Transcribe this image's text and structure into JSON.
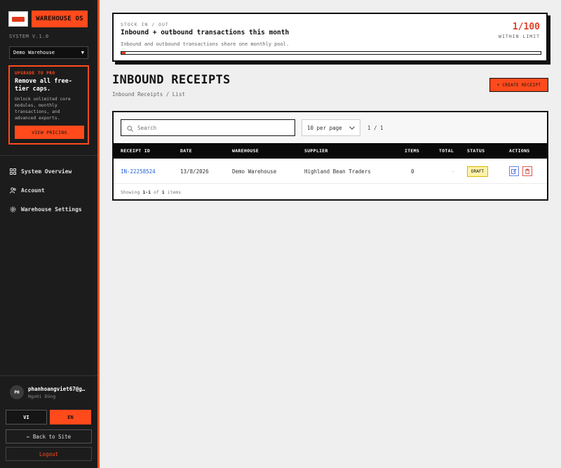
{
  "app": {
    "name": "WAREHOUSE OS",
    "version": "SYSTEM V.1.0",
    "warehouse_selected": "Demo Warehouse"
  },
  "promo": {
    "kicker": "UPGRADE TO PRO",
    "title": "Remove all free-tier caps.",
    "body": "Unlock unlimited core modules, monthly transactions, and advanced exports.",
    "button": "VIEW PRICING"
  },
  "nav": {
    "items": [
      {
        "label": "System Overview",
        "icon": "grid-icon"
      },
      {
        "label": "Account",
        "icon": "users-icon"
      },
      {
        "label": "Warehouse Settings",
        "icon": "gear-icon"
      }
    ]
  },
  "user": {
    "initials": "PH",
    "email": "phanhoangviet67@g…",
    "role": "Người Dùng"
  },
  "lang": {
    "vi": "VI",
    "en": "EN",
    "active": "EN"
  },
  "sidebar_footer": {
    "back": "← Back to Site",
    "logout": "Logout"
  },
  "usage": {
    "kicker": "STOCK IN / OUT",
    "title": "Inbound + outbound transactions this month",
    "description": "Inbound and outbound transactions share one monthly pool.",
    "count": "1/100",
    "caption": "WITHIN LIMIT",
    "used": 1,
    "limit": 100
  },
  "page": {
    "title": "INBOUND RECEIPTS",
    "breadcrumb": "Inbound Receipts / List",
    "create_button": "+ CREATE RECEIPT"
  },
  "table": {
    "search_placeholder": "Search",
    "per_page": "10 per page",
    "pagination": "1 / 1",
    "columns": [
      "RECEIPT ID",
      "DATE",
      "WAREHOUSE",
      "SUPPLIER",
      "ITEMS",
      "TOTAL",
      "STATUS",
      "ACTIONS"
    ],
    "rows": [
      {
        "id": "IN-22258524",
        "date": "13/8/2026",
        "warehouse": "Demo Warehouse",
        "supplier": "Highland Bean Traders",
        "items": "0",
        "total": "-",
        "status": "DRAFT"
      }
    ],
    "footer": {
      "prefix": "Showing",
      "range": "1-1",
      "of": "of",
      "total": "1",
      "suffix": "items"
    }
  },
  "colors": {
    "accent": "#ff4a1c",
    "sidebar": "#1c1c1c",
    "link": "#1f5fd6",
    "draft": "#fff3a8"
  }
}
